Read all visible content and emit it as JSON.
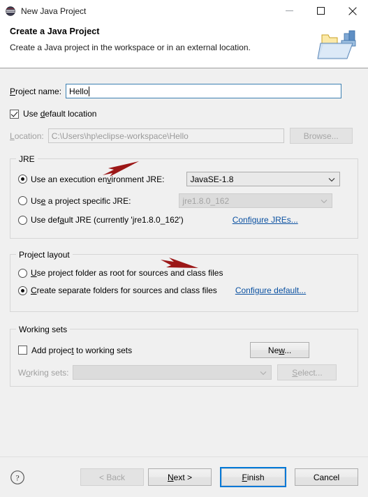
{
  "window": {
    "title": "New Java Project",
    "icon": "java-project-icon",
    "minimize_label": "Minimize",
    "maximize_label": "Maximize",
    "close_label": "Close"
  },
  "header": {
    "title": "Create a Java Project",
    "description": "Create a Java project in the workspace or in an external location.",
    "icon": "java-project-folder-icon"
  },
  "project": {
    "name_label": "Project name:",
    "name_value": "Hello",
    "use_default_location_label": "Use default location",
    "use_default_location_checked": true,
    "location_label": "Location:",
    "location_value": "C:\\Users\\hp\\eclipse-workspace\\Hello",
    "browse_label": "Browse..."
  },
  "jre": {
    "group_title": "JRE",
    "option_execution_env_label": "Use an execution environment JRE:",
    "option_execution_env_selected": true,
    "execution_env_value": "JavaSE-1.8",
    "option_project_specific_label": "Use a project specific JRE:",
    "option_project_specific_selected": false,
    "project_specific_value": "jre1.8.0_162",
    "option_default_jre_label": "Use default JRE (currently 'jre1.8.0_162')",
    "option_default_jre_selected": false,
    "configure_jres_link": "Configure JREs..."
  },
  "project_layout": {
    "group_title": "Project layout",
    "option_project_folder_root_label": "Use project folder as root for sources and class files",
    "option_project_folder_root_selected": false,
    "option_separate_folders_label": "Create separate folders for sources and class files",
    "option_separate_folders_selected": true,
    "configure_default_link": "Configure default..."
  },
  "working_sets": {
    "group_title": "Working sets",
    "add_project_label": "Add project to working sets",
    "add_project_checked": false,
    "new_button_label": "New...",
    "working_sets_label": "Working sets:",
    "working_sets_value": "",
    "select_button_label": "Select..."
  },
  "footer": {
    "help_label": "Help",
    "back_label": "< Back",
    "next_label": "Next >",
    "finish_label": "Finish",
    "cancel_label": "Cancel"
  },
  "annotations": {
    "arrow_color": "#9c1717",
    "arrow_project_name": "red-arrow-pointing-to-project-name",
    "arrow_jre_combo": "red-arrow-pointing-to-jre-combo"
  },
  "colors": {
    "accent": "#0078d7",
    "link": "#0b51a1",
    "dialog_background": "#f0f0f0",
    "header_background": "#ffffff",
    "field_focus_border": "#3c7fb1"
  }
}
